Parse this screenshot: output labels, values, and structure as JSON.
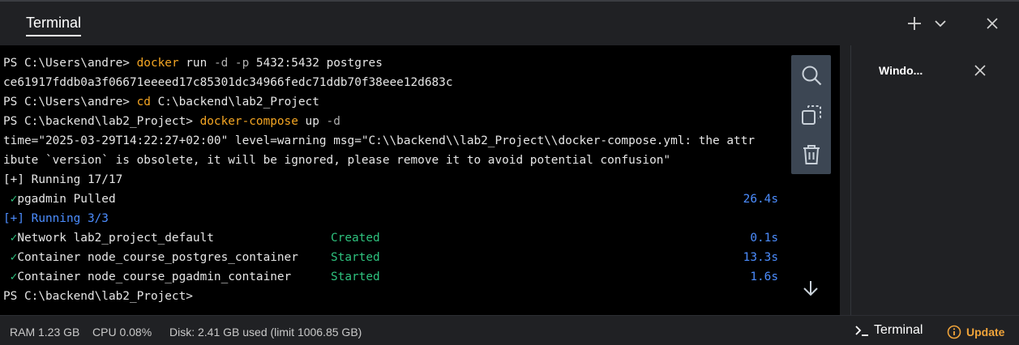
{
  "panel": {
    "tab_label": "Terminal",
    "new_terminal_icon": "plus-icon",
    "dropdown_icon": "chevron-down-icon",
    "close_icon": "close-icon"
  },
  "terminal": {
    "lines": [
      {
        "parts": [
          {
            "t": "PS C:\\Users\\andre> ",
            "c": ""
          },
          {
            "t": "docker",
            "c": "cmd"
          },
          {
            "t": " run ",
            "c": ""
          },
          {
            "t": "-d -p",
            "c": "flag"
          },
          {
            "t": " 5432:5432 postgres",
            "c": ""
          }
        ]
      },
      {
        "parts": [
          {
            "t": "ce61917fddb0a3f06671eeeed17c85301dc34966fedc71ddb70f38eee12d683c",
            "c": ""
          }
        ]
      },
      {
        "parts": [
          {
            "t": "PS C:\\Users\\andre> ",
            "c": ""
          },
          {
            "t": "cd",
            "c": "cmd"
          },
          {
            "t": " C:\\backend\\lab2_Project",
            "c": ""
          }
        ]
      },
      {
        "parts": [
          {
            "t": "PS C:\\backend\\lab2_Project> ",
            "c": ""
          },
          {
            "t": "docker-compose",
            "c": "cmd"
          },
          {
            "t": " up ",
            "c": ""
          },
          {
            "t": "-d",
            "c": "flag"
          }
        ]
      },
      {
        "parts": [
          {
            "t": "time=\"2025-03-29T14:22:27+02:00\" level=warning msg=\"C:\\\\backend\\\\lab2_Project\\\\docker-compose.yml: the attr",
            "c": ""
          }
        ]
      },
      {
        "parts": [
          {
            "t": "ibute `version` is obsolete, it will be ignored, please remove it to avoid potential confusion\"",
            "c": ""
          }
        ]
      },
      {
        "parts": [
          {
            "t": "[+] Running 17/17",
            "c": ""
          }
        ]
      },
      {
        "check": "✓",
        "parts": [
          {
            "t": "pgadmin Pulled",
            "c": ""
          }
        ],
        "time": "26.4s"
      },
      {
        "parts": [
          {
            "t": "[+] Running 3/3",
            "c": "blue"
          }
        ]
      },
      {
        "check": "✓",
        "parts": [
          {
            "t": "Network lab2_project_default",
            "c": ""
          }
        ],
        "status": "Created",
        "time": "0.1s"
      },
      {
        "check": "✓",
        "parts": [
          {
            "t": "Container node_course_postgres_container",
            "c": ""
          }
        ],
        "status": "Started",
        "time": "13.3s"
      },
      {
        "check": "✓",
        "parts": [
          {
            "t": "Container node_course_pgadmin_container",
            "c": ""
          }
        ],
        "status": "Started",
        "time": "1.6s"
      },
      {
        "parts": [
          {
            "t": "PS C:\\backend\\lab2_Project>",
            "c": ""
          }
        ]
      }
    ],
    "tools": [
      "search-icon",
      "copy-icon",
      "trash-icon"
    ],
    "scroll_icon": "arrow-down-icon"
  },
  "side_panel": {
    "title": "Windo...",
    "close_icon": "close-icon"
  },
  "status_bar": {
    "ram": "RAM 1.23 GB",
    "cpu": "CPU 0.08%",
    "disk": "Disk: 2.41 GB used (limit 1006.85 GB)",
    "terminal_label": "Terminal",
    "update_label": "Update"
  },
  "colors": {
    "background": "#202124",
    "terminal_bg": "#000000",
    "command": "#f5a623",
    "success": "#2ec27e",
    "info": "#4c8dff",
    "update": "#f0a43a"
  }
}
